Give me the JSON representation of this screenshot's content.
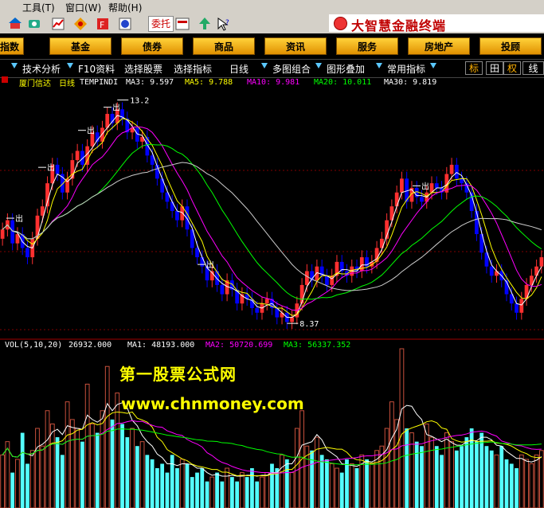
{
  "menu": {
    "tools": "工具(T)",
    "window": "窗口(W)",
    "help": "帮助(H)"
  },
  "toolbar": {
    "weituo": "委托"
  },
  "brand": {
    "title": "大智慧金融终端"
  },
  "categories": [
    "指数",
    "基金",
    "债券",
    "商品",
    "资讯",
    "服务",
    "房地产",
    "投顾"
  ],
  "func_bar": {
    "items": [
      "技术分析",
      "F10资料",
      "选择股票",
      "选择指标",
      "日线",
      "多图组合",
      "图形叠加",
      "常用指标"
    ],
    "right": [
      "标",
      "田",
      "权",
      "线"
    ]
  },
  "chart_info": {
    "stock": "厦门信达",
    "period": "日线",
    "formula": "TEMPINDI",
    "ma3": "MA3: 9.597",
    "ma5": "MA5: 9.788",
    "ma10": "MA10: 9.981",
    "ma20": "MA20: 10.011",
    "ma30": "MA30: 9.819"
  },
  "vol_info": {
    "vol": "VOL(5,10,20)",
    "vol_value": "26932.000",
    "ma1": "MA1: 48193.000",
    "ma2": "MA2: 50720.699",
    "ma3": "MA3: 56337.352"
  },
  "annotations": {
    "high": "13.2",
    "low": "8.37",
    "signal": "出"
  },
  "watermark": {
    "line1": "第一股票公式网",
    "line2": "www.chnmoney.com"
  },
  "colors": {
    "up": "#ff3030",
    "down": "#0000ff",
    "ma1": "#ffffff",
    "ma2": "#ffff00",
    "ma3": "#ff00ff",
    "ma4": "#00ff00",
    "vol_up": "#c8503c",
    "vol_down": "#54ffff"
  },
  "chart_data": {
    "type": "candlestick",
    "price_range": [
      8.37,
      13.2
    ],
    "closes": [
      10.4,
      10.6,
      10.1,
      10.3,
      10.0,
      9.8,
      10.2,
      10.7,
      10.9,
      11.4,
      11.8,
      11.6,
      11.2,
      11.5,
      11.9,
      12.1,
      11.8,
      12.2,
      12.5,
      12.3,
      12.6,
      12.9,
      12.7,
      13.0,
      12.8,
      12.5,
      12.6,
      12.3,
      12.4,
      12.0,
      11.8,
      11.5,
      11.2,
      11.0,
      10.8,
      10.6,
      10.9,
      10.4,
      10.0,
      9.8,
      9.6,
      9.3,
      9.5,
      9.2,
      9.0,
      9.3,
      9.1,
      8.8,
      9.0,
      8.9,
      8.7,
      8.6,
      8.8,
      8.9,
      8.7,
      8.5,
      8.6,
      8.4,
      8.5,
      8.8,
      9.2,
      9.5,
      9.3,
      9.6,
      9.4,
      9.2,
      9.4,
      9.7,
      9.5,
      9.4,
      9.6,
      9.5,
      9.8,
      9.6,
      9.7,
      10.0,
      10.2,
      10.6,
      10.9,
      11.2,
      11.5,
      11.0,
      11.3,
      11.1,
      11.0,
      11.2,
      11.4,
      11.3,
      11.2,
      11.6,
      11.8,
      11.5,
      11.4,
      11.2,
      10.8,
      10.3,
      9.9,
      9.6,
      9.4,
      9.5,
      9.3,
      9.0,
      8.8,
      8.6,
      8.9,
      9.2,
      9.4,
      9.6,
      9.8
    ],
    "volumes": [
      60,
      75,
      40,
      55,
      85,
      50,
      65,
      90,
      70,
      110,
      95,
      80,
      60,
      120,
      100,
      90,
      75,
      140,
      95,
      85,
      110,
      160,
      100,
      130,
      95,
      80,
      90,
      70,
      75,
      60,
      55,
      45,
      50,
      40,
      60,
      45,
      55,
      50,
      35,
      40,
      45,
      30,
      35,
      40,
      30,
      45,
      35,
      30,
      40,
      35,
      45,
      30,
      35,
      40,
      50,
      45,
      60,
      55,
      40,
      90,
      110,
      70,
      65,
      80,
      60,
      55,
      50,
      45,
      40,
      55,
      50,
      45,
      60,
      55,
      50,
      65,
      70,
      90,
      120,
      100,
      180,
      90,
      85,
      75,
      70,
      95,
      80,
      70,
      60,
      85,
      75,
      65,
      70,
      80,
      90,
      75,
      85,
      70,
      65,
      60,
      70,
      55,
      50,
      45,
      60,
      55,
      50,
      60,
      65
    ]
  }
}
